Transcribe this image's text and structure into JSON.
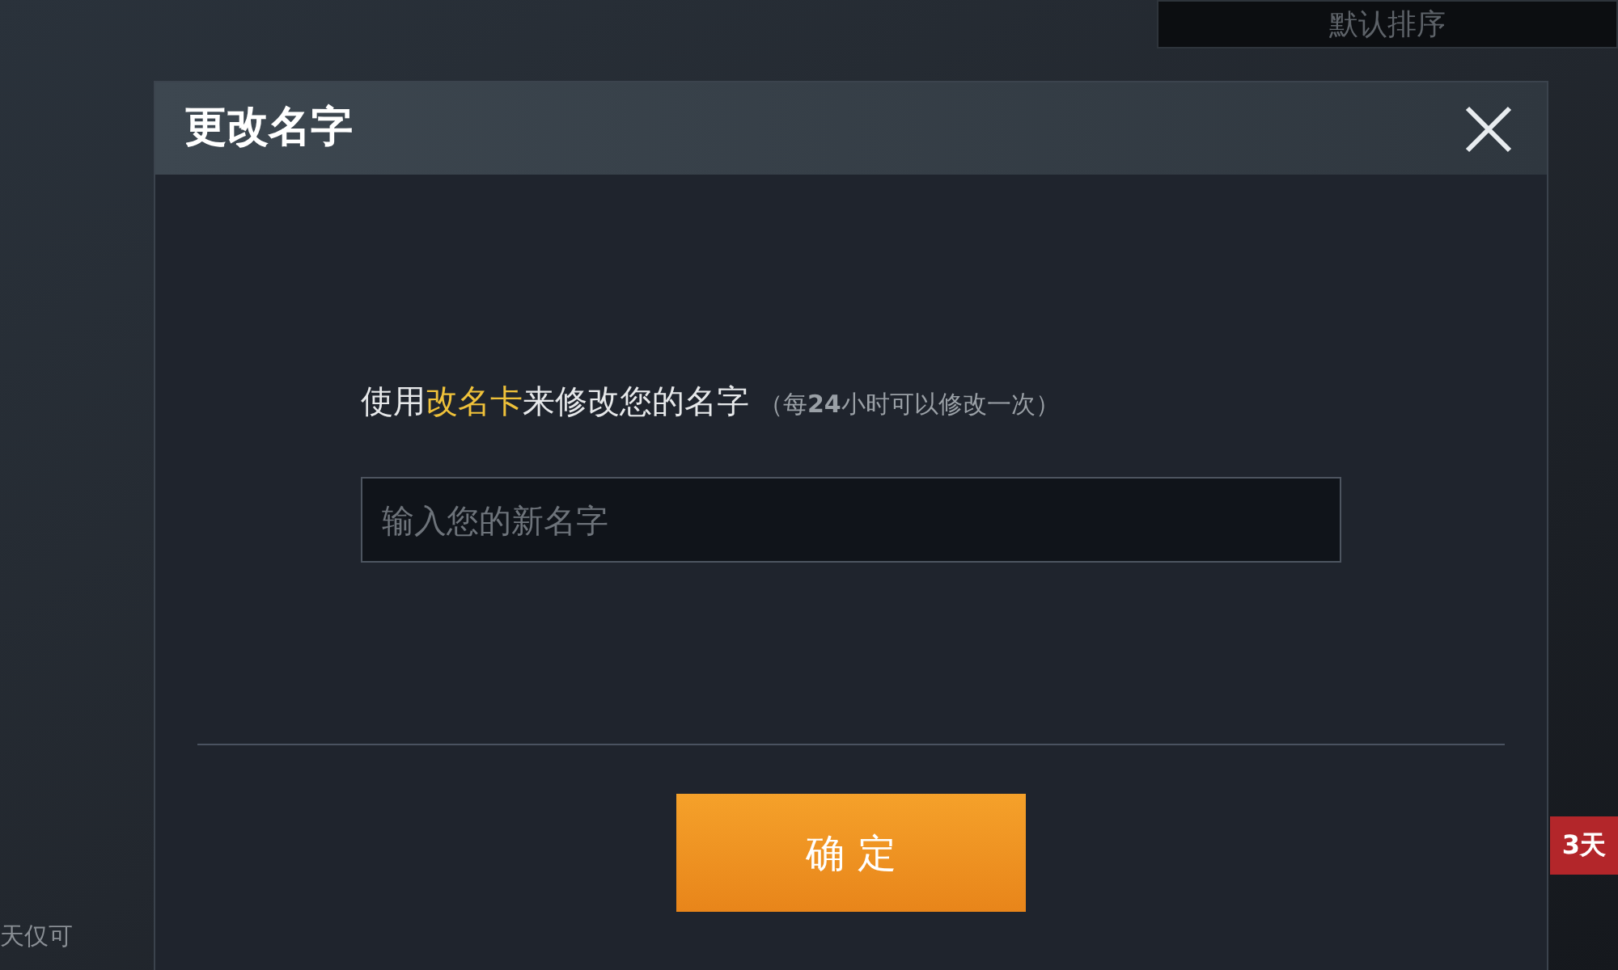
{
  "background": {
    "sort_label": "默认排序",
    "left_caption": "天仅可",
    "badge": "3天"
  },
  "dialog": {
    "title": "更改名字",
    "message": {
      "before": "使用",
      "highlight": "改名卡",
      "after": "来修改您的名字"
    },
    "note": "（每**24**小时可以修改一次）",
    "input": {
      "placeholder": "输入您的新名字"
    },
    "confirm": "确 定"
  }
}
